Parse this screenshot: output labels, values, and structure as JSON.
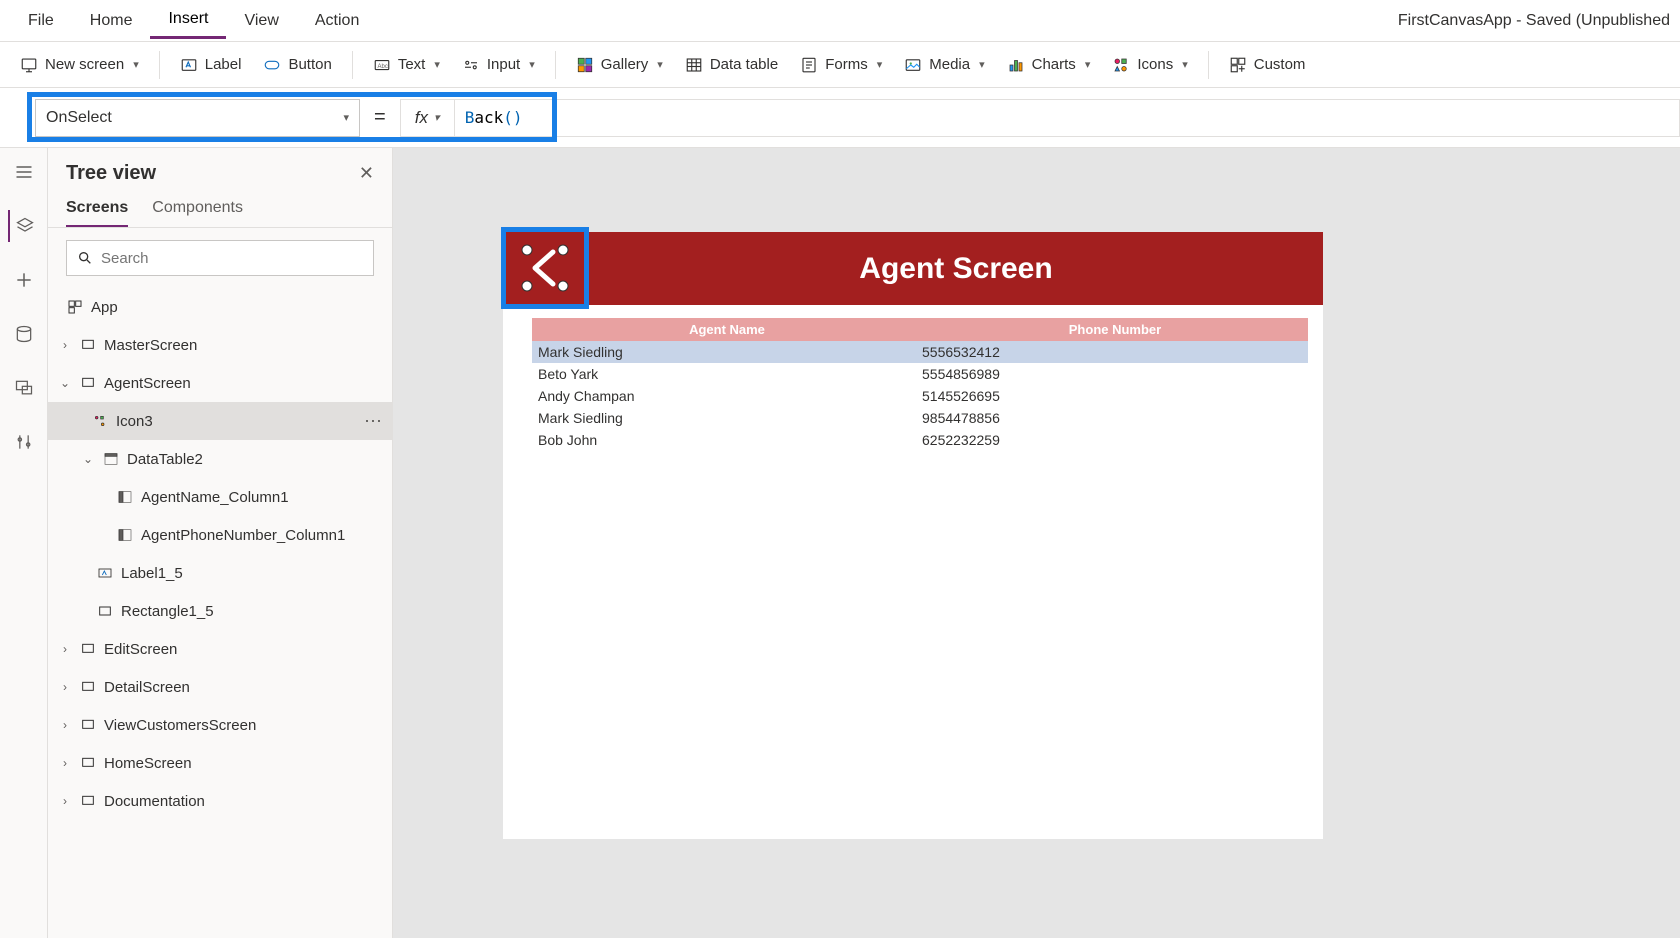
{
  "app_title": "FirstCanvasApp - Saved (Unpublished",
  "menu": {
    "file": "File",
    "home": "Home",
    "insert": "Insert",
    "view": "View",
    "action": "Action"
  },
  "ribbon": {
    "new_screen": "New screen",
    "label": "Label",
    "button": "Button",
    "text": "Text",
    "input": "Input",
    "gallery": "Gallery",
    "data_table": "Data table",
    "forms": "Forms",
    "media": "Media",
    "charts": "Charts",
    "icons": "Icons",
    "custom": "Custom"
  },
  "formula": {
    "property": "OnSelect",
    "fx": "fx",
    "value_prefix": "B",
    "value_fn": "ack",
    "value_paren": "()"
  },
  "tree": {
    "title": "Tree view",
    "tab_screens": "Screens",
    "tab_components": "Components",
    "search_placeholder": "Search",
    "app": "App",
    "nodes": {
      "master": "MasterScreen",
      "agent": "AgentScreen",
      "icon3": "Icon3",
      "datatable2": "DataTable2",
      "agentname_col": "AgentName_Column1",
      "agentphone_col": "AgentPhoneNumber_Column1",
      "label1_5": "Label1_5",
      "rectangle1_5": "Rectangle1_5",
      "edit": "EditScreen",
      "detail": "DetailScreen",
      "viewcustomers": "ViewCustomersScreen",
      "home": "HomeScreen",
      "documentation": "Documentation"
    }
  },
  "screen": {
    "title": "Agent Screen",
    "header_col1": "Agent Name",
    "header_col2": "Phone Number",
    "rows": [
      {
        "name": "Mark Siedling",
        "phone": "5556532412"
      },
      {
        "name": "Beto Yark",
        "phone": "5554856989"
      },
      {
        "name": "Andy Champan",
        "phone": "5145526695"
      },
      {
        "name": "Mark Siedling",
        "phone": "9854478856"
      },
      {
        "name": "Bob John",
        "phone": "6252232259"
      }
    ]
  }
}
